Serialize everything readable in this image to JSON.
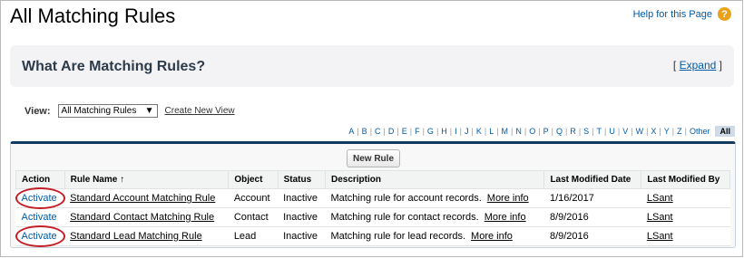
{
  "header": {
    "title": "All Matching Rules",
    "help_link": "Help for this Page",
    "help_icon": "?"
  },
  "info": {
    "title": "What Are Matching Rules?",
    "expand_open": "[",
    "expand_label": "Expand",
    "expand_close": "]"
  },
  "view": {
    "label": "View:",
    "selected": "All Matching Rules",
    "arrow": "▼",
    "create_new": "Create New View"
  },
  "alphabet": [
    "A",
    "B",
    "C",
    "D",
    "E",
    "F",
    "G",
    "H",
    "I",
    "J",
    "K",
    "L",
    "M",
    "N",
    "O",
    "P",
    "Q",
    "R",
    "S",
    "T",
    "U",
    "V",
    "W",
    "X",
    "Y",
    "Z",
    "Other",
    "All"
  ],
  "list": {
    "new_rule_label": "New Rule",
    "columns": [
      "Action",
      "Rule Name ↑",
      "Object",
      "Status",
      "Description",
      "Last Modified Date",
      "Last Modified By"
    ],
    "rows": [
      {
        "action": "Activate",
        "name": "Standard Account Matching Rule",
        "object": "Account",
        "status": "Inactive",
        "description": "Matching rule for account records.",
        "more": "More info",
        "date": "1/16/2017",
        "by": "LSant",
        "circled": true
      },
      {
        "action": "Activate",
        "name": "Standard Contact Matching Rule",
        "object": "Contact",
        "status": "Inactive",
        "description": "Matching rule for contact records.",
        "more": "More info",
        "date": "8/9/2016",
        "by": "LSant",
        "circled": false
      },
      {
        "action": "Activate",
        "name": "Standard Lead Matching Rule",
        "object": "Lead",
        "status": "Inactive",
        "description": "Matching rule for lead records.",
        "more": "More info",
        "date": "8/9/2016",
        "by": "LSant",
        "circled": true
      }
    ]
  },
  "colors": {
    "link": "#015ba7",
    "panel_top": "#15385e",
    "annotation": "#c41e25",
    "help_icon": "#e8a21a"
  }
}
